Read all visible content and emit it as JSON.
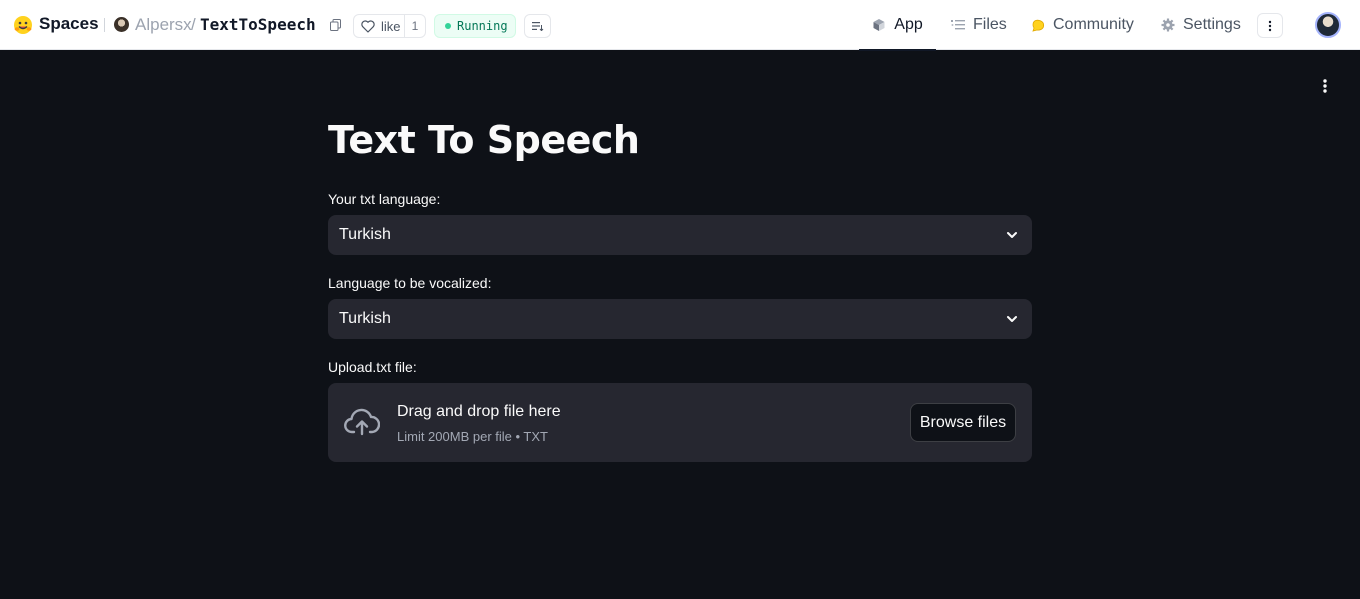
{
  "header": {
    "brand": "Spaces",
    "owner": "Alpersx",
    "separator": "/",
    "repo": "TextToSpeech",
    "like_label": "like",
    "like_count": "1",
    "status": "Running",
    "nav": {
      "app": "App",
      "files": "Files",
      "community": "Community",
      "settings": "Settings"
    }
  },
  "app": {
    "title": "Text To Speech",
    "source_language": {
      "label": "Your txt language:",
      "value": "Turkish"
    },
    "target_language": {
      "label": "Language to be vocalized:",
      "value": "Turkish"
    },
    "uploader": {
      "label": "Upload.txt file:",
      "title": "Drag and drop file here",
      "limits": "Limit 200MB per file • TXT",
      "button": "Browse files"
    }
  },
  "colors": {
    "background": "#0e1117",
    "widget": "#262730",
    "text": "#fafafa",
    "status_green": "#34d399"
  }
}
